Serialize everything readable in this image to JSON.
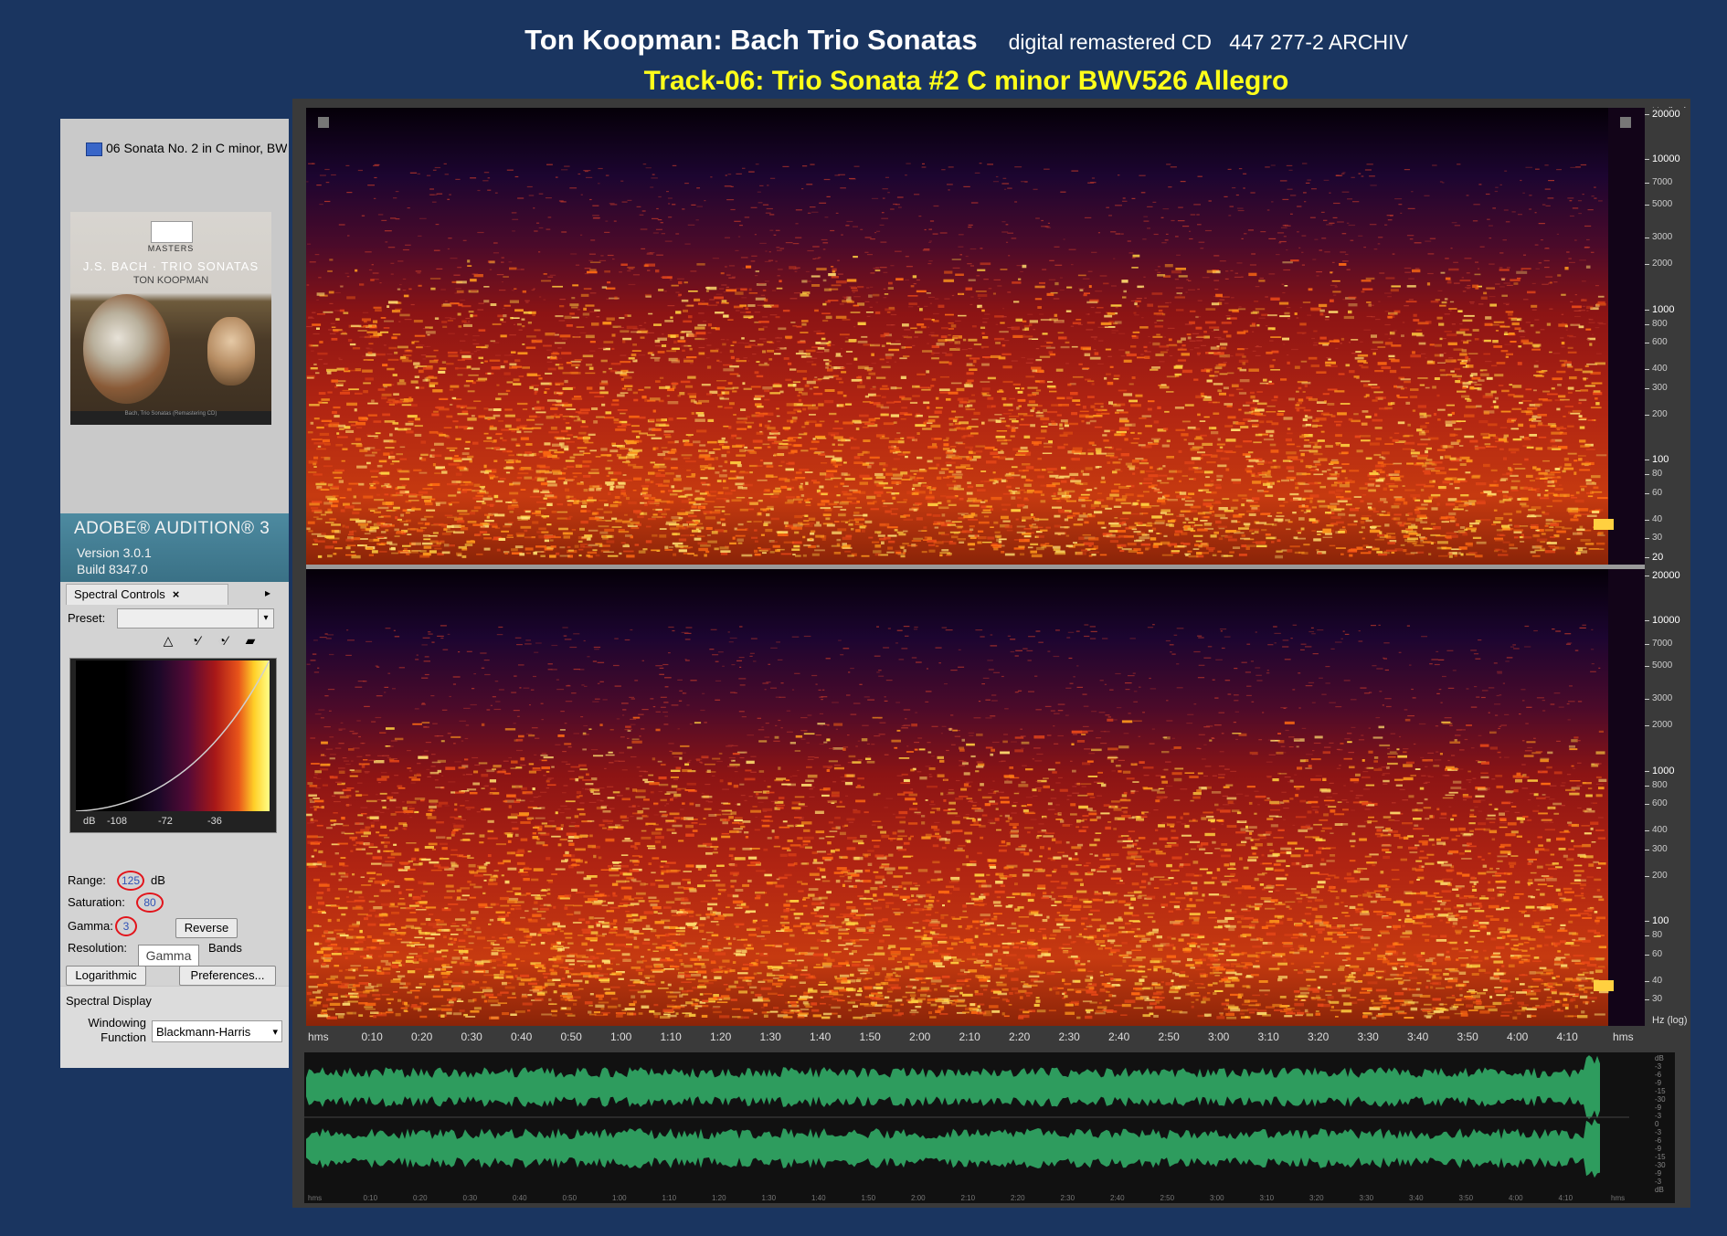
{
  "title": {
    "main": "Ton Koopman: Bach Trio Sonatas",
    "sub": "digital remastered CD   447 277-2 ARCHIV",
    "track": "Track-06: Trio Sonata #2 C minor BWV526 Allegro"
  },
  "file_panel": {
    "file_name": "06 Sonata No. 2 in C minor, BW",
    "file_icon": "wav-file-icon"
  },
  "album_art": {
    "label_badge": "ARCHIV",
    "series": "MASTERS",
    "title": "J.S. BACH · TRIO SONATAS",
    "artist": "TON KOOPMAN",
    "bottom_text": "Bach, Trio Sonatas (Remastering CD)"
  },
  "app": {
    "name": "ADOBE® AUDITION® 3",
    "version": "Version 3.0.1",
    "build": "Build 8347.0"
  },
  "spectral_controls": {
    "tab_label": "Spectral Controls",
    "close_glyph": "×",
    "menu_glyph": "▸",
    "preset_label": "Preset:",
    "preset_value": "",
    "preset_arrow": "▾",
    "tools": [
      "△",
      "◔⁄",
      "◔⁄",
      "▰"
    ],
    "colormap_axis": [
      "dB",
      "-108",
      "-72",
      "-36"
    ],
    "range_label": "Range:",
    "range_value": "125",
    "range_unit": "dB",
    "saturation_label": "Saturation:",
    "saturation_value": "80",
    "gamma_label": "Gamma:",
    "gamma_value": "3",
    "reverse_button": "Reverse",
    "resolution_label": "Resolution:",
    "bands_label": "Bands",
    "gamma_tooltip": "Gamma",
    "logarithmic_button": "Logarithmic",
    "preferences_button": "Preferences..."
  },
  "spectral_display": {
    "title": "Spectral Display",
    "windowing_label_1": "Windowing",
    "windowing_label_2": "Function",
    "windowing_value": "Blackmann-Harris",
    "windowing_arrow": "▾"
  },
  "spectrogram": {
    "freq_axis_title": "Hz (log)",
    "freq_labels_top": [
      "20000",
      "10000",
      "7000",
      "5000",
      "3000",
      "2000",
      "1000",
      "800",
      "600",
      "400",
      "300",
      "200",
      "100",
      "80",
      "60",
      "40",
      "30",
      "20"
    ],
    "freq_labels_bottom": [
      "20000",
      "10000",
      "7000",
      "5000",
      "3000",
      "2000",
      "1000",
      "800",
      "600",
      "400",
      "300",
      "200",
      "100",
      "80",
      "60",
      "40",
      "30"
    ],
    "time_labels": [
      "hms",
      "0:10",
      "0:20",
      "0:30",
      "0:40",
      "0:50",
      "1:00",
      "1:10",
      "1:20",
      "1:30",
      "1:40",
      "1:50",
      "2:00",
      "2:10",
      "2:20",
      "2:30",
      "2:40",
      "2:50",
      "3:00",
      "3:10",
      "3:20",
      "3:30",
      "3:40",
      "3:50",
      "4:00",
      "4:10",
      "hms"
    ]
  },
  "waveform": {
    "color": "#2e9c5e",
    "db_labels": [
      "dB",
      "-3",
      "-6",
      "-9",
      "-15",
      "-30",
      "-9",
      "-3",
      "0",
      "-3",
      "-6",
      "-9",
      "-15",
      "-30",
      "-9",
      "-3",
      "dB"
    ]
  },
  "colors": {
    "background": "#1a3560",
    "title": "#ffffff",
    "track": "#ffff1a",
    "highlight_circle": "#e2141b"
  }
}
